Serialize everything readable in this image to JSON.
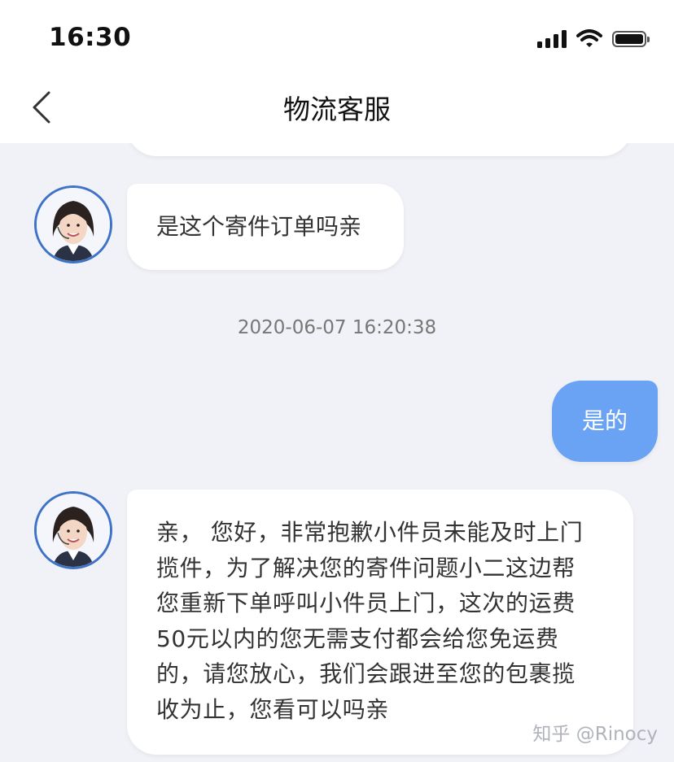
{
  "status_bar": {
    "time": "16:30"
  },
  "header": {
    "title": "物流客服"
  },
  "messages": {
    "first": "是这个寄件订单吗亲",
    "timestamp": "2020-06-07 16:20:38",
    "sent": "是的",
    "reply_lines": [
      "亲， 您好，非常抱歉小件员未能及时上门",
      "揽件，为了解决您的寄件问题小二这边帮",
      "您重新下单呼叫小件员上门，这次的运费",
      "50元以内的您无需支付都会给您免运费",
      "的，请您放心，我们会跟进至您的包裹揽",
      "收为止，您看可以吗亲"
    ]
  },
  "watermark": "知乎 @Rinocy",
  "colors": {
    "sent_bubble": "#6aa3f3",
    "avatar_ring": "#3f73c7",
    "background": "#f1f2f7"
  }
}
